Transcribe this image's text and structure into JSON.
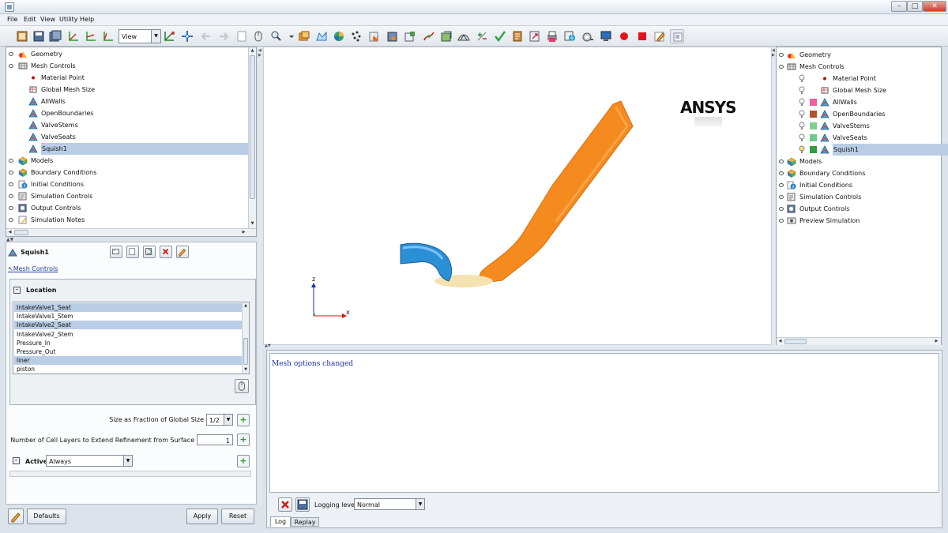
{
  "window": {
    "minimize": "–",
    "maximize": "□",
    "close": "✕"
  },
  "menu": [
    "File",
    "Edit",
    "View",
    "Utility",
    "Help"
  ],
  "toolbar": {
    "view_value": "View"
  },
  "left_tree": {
    "items": [
      {
        "label": "Geometry",
        "level": 0,
        "icon": "geometry-icon",
        "expanded": false
      },
      {
        "label": "Mesh Controls",
        "level": 0,
        "icon": "mesh-controls-icon",
        "expanded": true
      },
      {
        "label": "Material Point",
        "level": 1,
        "icon": "material-point-icon"
      },
      {
        "label": "Global Mesh Size",
        "level": 1,
        "icon": "global-mesh-icon"
      },
      {
        "label": "AllWalls",
        "level": 1,
        "icon": "mesh-region-icon"
      },
      {
        "label": "OpenBoundaries",
        "level": 1,
        "icon": "mesh-region-icon"
      },
      {
        "label": "ValveStems",
        "level": 1,
        "icon": "mesh-region-icon"
      },
      {
        "label": "ValveSeats",
        "level": 1,
        "icon": "mesh-region-icon"
      },
      {
        "label": "Squish1",
        "level": 1,
        "icon": "mesh-region-icon",
        "selected": true
      },
      {
        "label": "Models",
        "level": 0,
        "icon": "models-icon",
        "expanded": false
      },
      {
        "label": "Boundary Conditions",
        "level": 0,
        "icon": "boundary-conditions-icon"
      },
      {
        "label": "Initial Conditions",
        "level": 0,
        "icon": "initial-conditions-icon",
        "expanded": false
      },
      {
        "label": "Simulation Controls",
        "level": 0,
        "icon": "simulation-controls-icon",
        "expanded": false
      },
      {
        "label": "Output Controls",
        "level": 0,
        "icon": "output-controls-icon",
        "expanded": false
      },
      {
        "label": "Simulation Notes",
        "level": 0,
        "icon": "simulation-notes-icon"
      }
    ]
  },
  "props": {
    "title": "Squish1",
    "parent_link": "Mesh Controls",
    "location_title": "Location",
    "location_items": [
      {
        "label": "IntakeValve1_Seat",
        "selected": true
      },
      {
        "label": "IntakeValve1_Stem",
        "selected": false
      },
      {
        "label": "IntakeValve2_Seat",
        "selected": true
      },
      {
        "label": "IntakeValve2_Stem",
        "selected": false
      },
      {
        "label": "Pressure_In",
        "selected": false
      },
      {
        "label": "Pressure_Out",
        "selected": false
      },
      {
        "label": "liner",
        "selected": true
      },
      {
        "label": "piston",
        "selected": false
      }
    ],
    "size_label": "Size as Fraction of Global Size",
    "size_value": "1/2",
    "layers_label": "Number of Cell Layers to Extend Refinement from Surface",
    "layers_value": "1",
    "active_label": "Active",
    "active_value": "Always",
    "defaults_btn": "Defaults",
    "apply_btn": "Apply",
    "reset_btn": "Reset"
  },
  "viewport": {
    "logo": "ANSYS",
    "axis_z": "z",
    "axis_x": "x"
  },
  "right_tree": {
    "items": [
      {
        "label": "Geometry",
        "level": 0,
        "icon": "geometry-icon"
      },
      {
        "label": "Mesh Controls",
        "level": 0,
        "icon": "mesh-controls-icon"
      },
      {
        "label": "Material Point",
        "level": 1,
        "icon": "material-point-icon",
        "color": ""
      },
      {
        "label": "Global Mesh Size",
        "level": 1,
        "icon": "global-mesh-icon",
        "color": ""
      },
      {
        "label": "AllWalls",
        "level": 1,
        "icon": "mesh-region-icon",
        "color": "#ee5ea0"
      },
      {
        "label": "OpenBoundaries",
        "level": 1,
        "icon": "mesh-region-icon",
        "color": "#b5532b"
      },
      {
        "label": "ValveStems",
        "level": 1,
        "icon": "mesh-region-icon",
        "color": "#7fcf8f"
      },
      {
        "label": "ValveSeats",
        "level": 1,
        "icon": "mesh-region-icon",
        "color": "#6fc98a"
      },
      {
        "label": "Squish1",
        "level": 1,
        "icon": "mesh-region-icon",
        "color": "#2e9e3e",
        "selected": true
      },
      {
        "label": "Models",
        "level": 0,
        "icon": "models-icon"
      },
      {
        "label": "Boundary Conditions",
        "level": 0,
        "icon": "boundary-conditions-icon"
      },
      {
        "label": "Initial Conditions",
        "level": 0,
        "icon": "initial-conditions-icon"
      },
      {
        "label": "Simulation Controls",
        "level": 0,
        "icon": "simulation-controls-icon"
      },
      {
        "label": "Output Controls",
        "level": 0,
        "icon": "output-controls-icon"
      },
      {
        "label": "Preview Simulation",
        "level": 0,
        "icon": "preview-simulation-icon"
      }
    ]
  },
  "log": {
    "message": "Mesh options changed",
    "logging_label": "Logging level:",
    "logging_value": "Normal",
    "tabs": [
      "Log",
      "Replay"
    ]
  },
  "colors": {
    "selection": "#b9cde5",
    "orange": "#f58a1f",
    "blue": "#2b8fd6",
    "link": "#1a3fa0",
    "log_text": "#1b2fb0"
  }
}
